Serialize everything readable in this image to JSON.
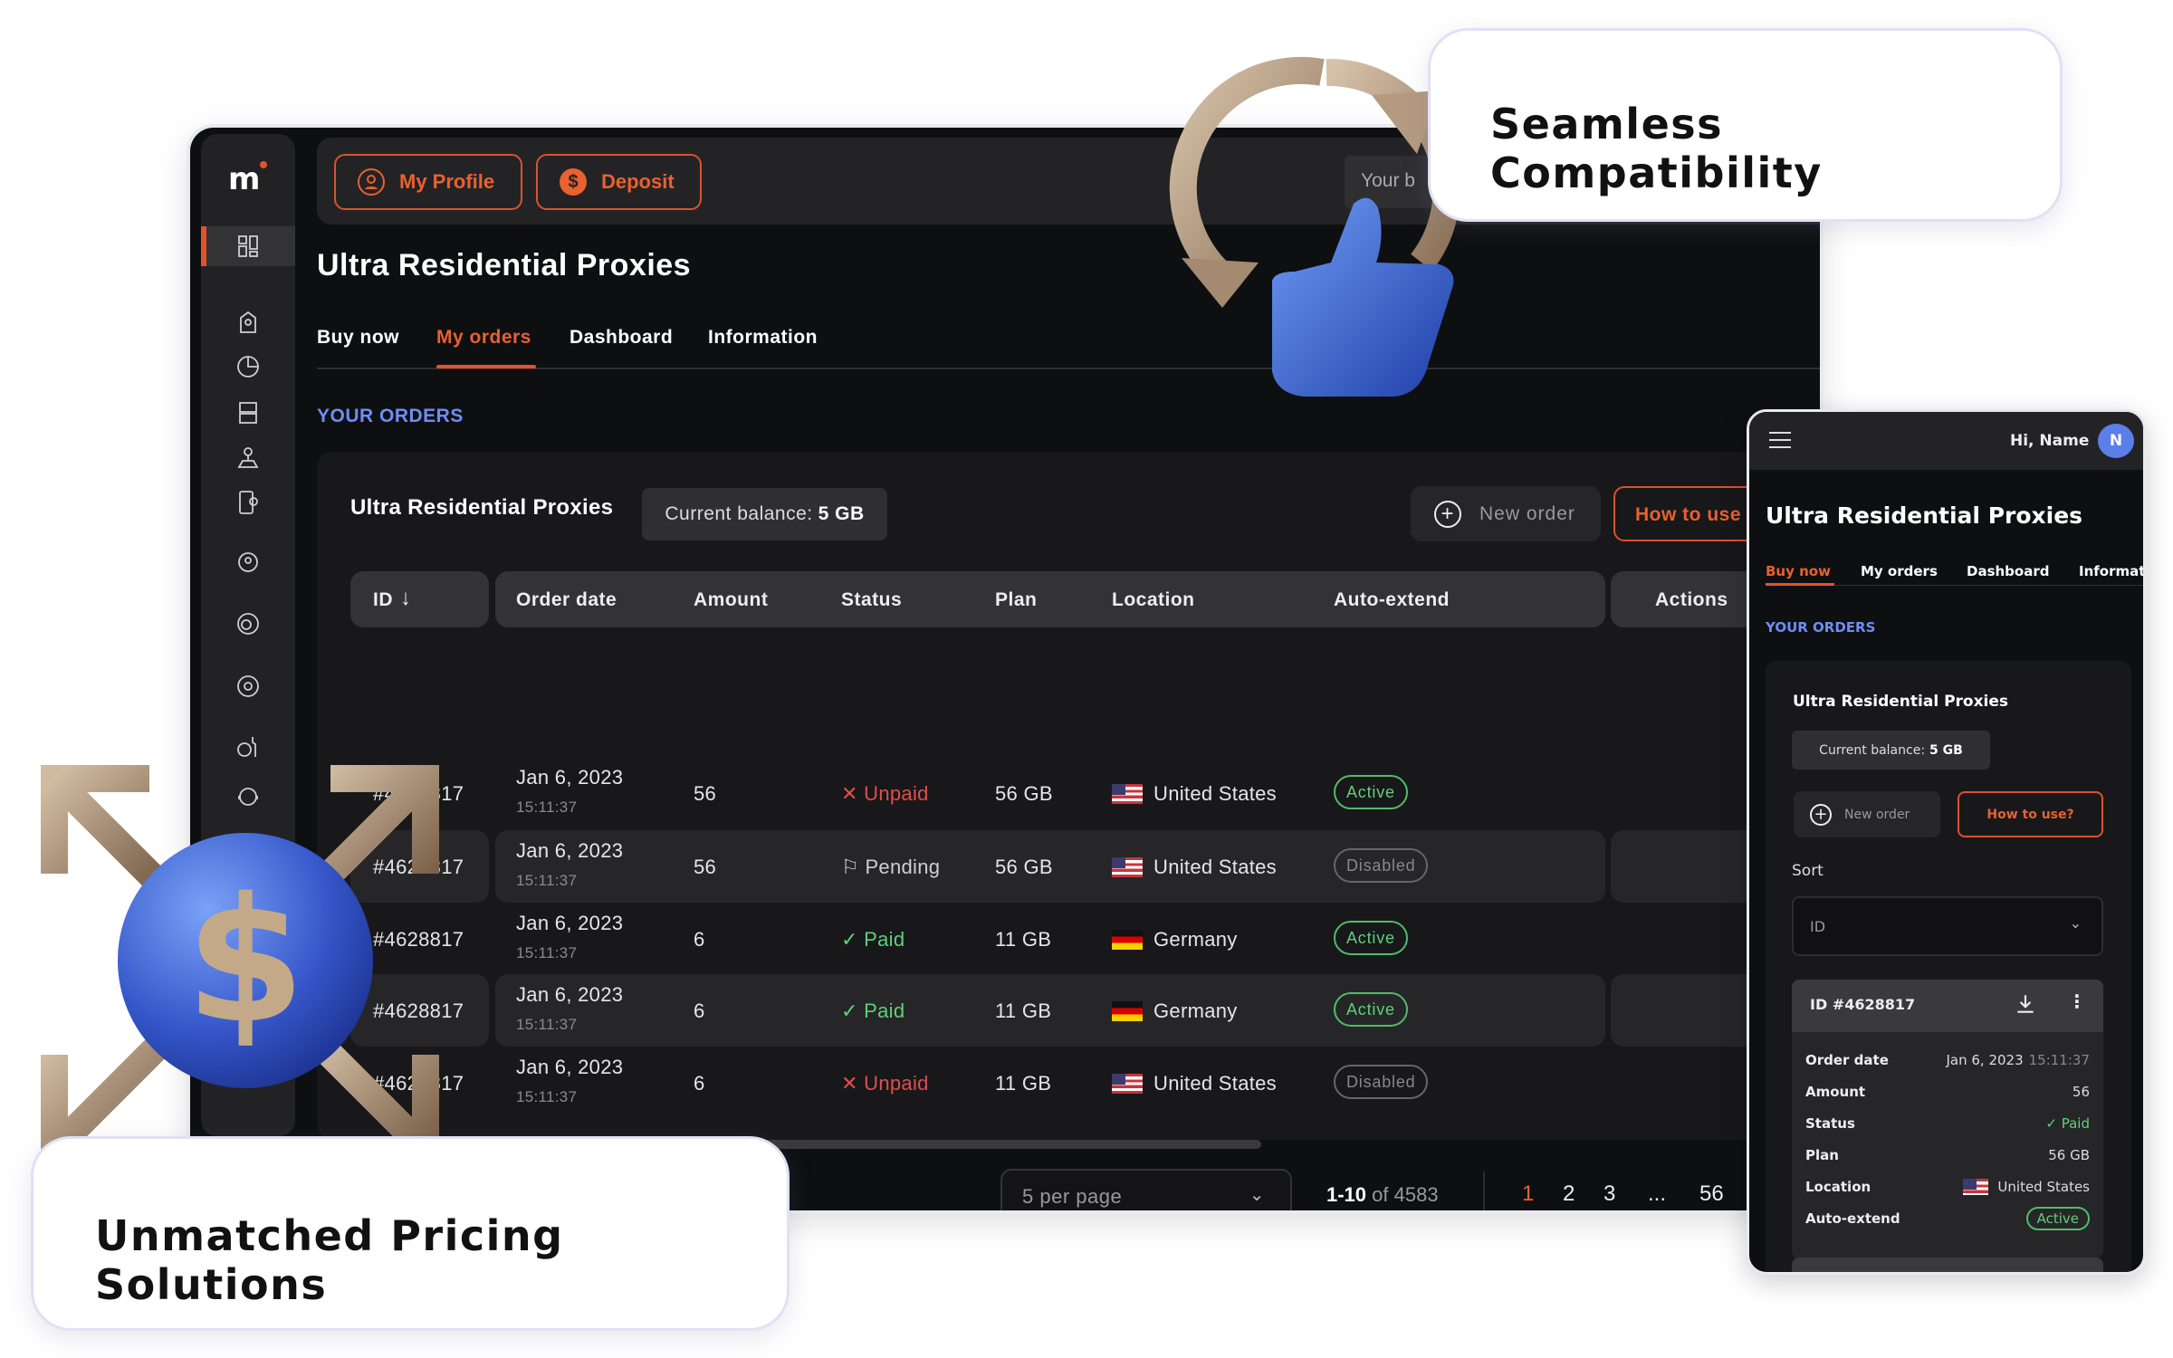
{
  "colors": {
    "accent": "#e2522b",
    "link_blue": "#6f8df5",
    "active_green": "#5fd07a",
    "unpaid_red": "#e24d4d"
  },
  "sidebar": {
    "logo": "m",
    "items": [
      {
        "icon": "dashboard-icon",
        "active": true
      },
      {
        "icon": "location-pin-icon"
      },
      {
        "icon": "pie-chart-icon"
      },
      {
        "icon": "server-icon"
      },
      {
        "icon": "user-location-icon"
      },
      {
        "icon": "mobile-location-icon"
      },
      {
        "icon": "network-user-icon"
      },
      {
        "icon": "firefox-icon"
      },
      {
        "icon": "chrome-icon"
      },
      {
        "icon": "help-tool-icon"
      },
      {
        "icon": "support-icon"
      },
      {
        "icon": "users-icon"
      }
    ]
  },
  "topbar": {
    "profile_label": "My Profile",
    "deposit_label": "Deposit",
    "balance_input_partial": "Your b"
  },
  "page": {
    "title": "Ultra Residential Proxies",
    "tabs": [
      {
        "label": "Buy now"
      },
      {
        "label": "My orders",
        "active": true
      },
      {
        "label": "Dashboard"
      },
      {
        "label": "Information"
      }
    ],
    "section_label": "YOUR ORDERS"
  },
  "card": {
    "title": "Ultra Residential Proxies",
    "balance_label": "Current balance:",
    "balance_value": "5 GB",
    "new_order_label": "New order",
    "how_to_label": "How to use"
  },
  "table": {
    "columns": [
      "ID",
      "Order date",
      "Amount",
      "Status",
      "Plan",
      "Location",
      "Auto-extend",
      "Actions"
    ],
    "sort": "descending",
    "rows": [
      {
        "id": "#4628817",
        "date": "Jan 6, 2023",
        "time": "15:11:37",
        "amount": "56",
        "status": "Unpaid",
        "plan": "56 GB",
        "location": "United States",
        "flag": "us",
        "auto": "Active",
        "actions": [
          "download",
          "more"
        ]
      },
      {
        "id": "#4628817",
        "date": "Jan 6, 2023",
        "time": "15:11:37",
        "amount": "56",
        "status": "Pending",
        "plan": "56 GB",
        "location": "United States",
        "flag": "us",
        "auto": "Disabled",
        "actions": [
          "delete",
          "pay",
          "more"
        ]
      },
      {
        "id": "#4628817",
        "date": "Jan 6, 2023",
        "time": "15:11:37",
        "amount": "6",
        "status": "Paid",
        "plan": "11 GB",
        "location": "Germany",
        "flag": "de",
        "auto": "Active",
        "actions": [
          "delete",
          "pay",
          "more"
        ]
      },
      {
        "id": "#4628817",
        "date": "Jan 6, 2023",
        "time": "15:11:37",
        "amount": "6",
        "status": "Paid",
        "plan": "11 GB",
        "location": "Germany",
        "flag": "de",
        "auto": "Active",
        "actions": [
          "delete",
          "pay",
          "more"
        ]
      },
      {
        "id": "#4628817",
        "date": "Jan 6, 2023",
        "time": "15:11:37",
        "amount": "6",
        "status": "Unpaid",
        "plan": "11 GB",
        "location": "United States",
        "flag": "us",
        "auto": "Disabled",
        "actions": [
          "delete",
          "pay",
          "more"
        ]
      }
    ]
  },
  "pagination": {
    "per_page": "5 per page",
    "range": "1-10",
    "of_total": "of 4583",
    "pages": [
      "1",
      "2",
      "3",
      "...",
      "56"
    ],
    "current": "1"
  },
  "mobile": {
    "greeting": "Hi, Name",
    "avatar": "N",
    "title": "Ultra Residential Proxies",
    "tabs": [
      {
        "label": "Buy now",
        "active": true
      },
      {
        "label": "My orders"
      },
      {
        "label": "Dashboard"
      },
      {
        "label": "Informati"
      }
    ],
    "section_label": "YOUR ORDERS",
    "card_title": "Ultra Residential Proxies",
    "balance_label": "Current balance:",
    "balance_value": "5 GB",
    "new_order_label": "New order",
    "how_to_label": "How to use?",
    "sort_label": "Sort",
    "sort_value": "ID",
    "order": {
      "id_label": "ID #4628817",
      "fields": [
        {
          "label": "Order date",
          "value": "Jan 6, 2023",
          "time": "15:11:37"
        },
        {
          "label": "Amount",
          "value": "56"
        },
        {
          "label": "Status",
          "value": "Paid"
        },
        {
          "label": "Plan",
          "value": "56 GB"
        },
        {
          "label": "Location",
          "value": "United States"
        },
        {
          "label": "Auto-extend",
          "value": "Active"
        }
      ]
    }
  },
  "callouts": {
    "top": "Seamless Compatibility",
    "bottom": "Unmatched Pricing Solutions"
  },
  "graphics": {
    "coin_symbol": "$"
  }
}
